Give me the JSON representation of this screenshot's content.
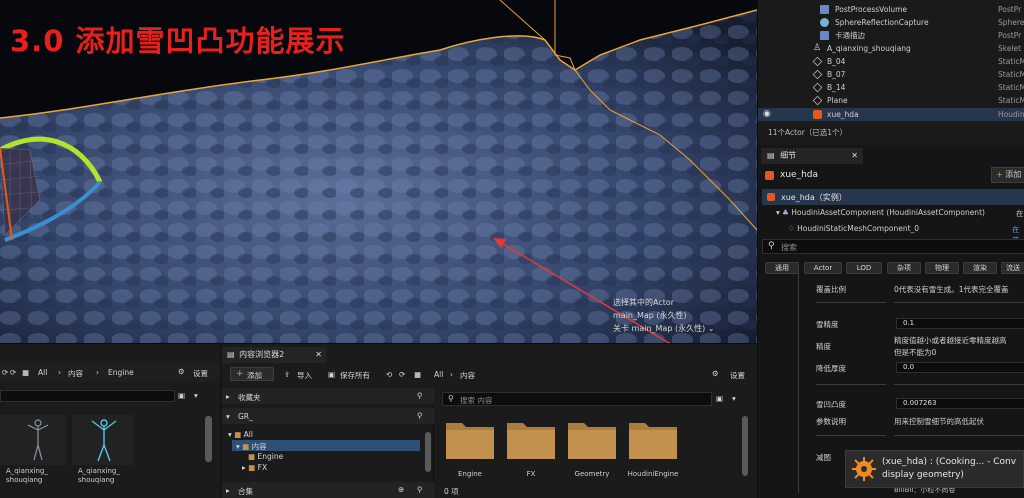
{
  "viewport": {
    "title": "3.0 添加雪凹凸功能展示",
    "info": [
      "选择其中的Actor",
      "main_Map (永久性)",
      "关卡 main_Map (永久性)"
    ]
  },
  "outliner": {
    "rows": [
      {
        "name": "PostProcessVolume",
        "type": "PostPr",
        "icon": "postprocess-icon"
      },
      {
        "name": "SphereReflectionCapture",
        "type": "SphereR",
        "icon": "sphere-capture-icon"
      },
      {
        "name": "卡通描边",
        "type": "PostPr",
        "icon": "postprocess-icon"
      },
      {
        "name": "A_qianxing_shouqiang",
        "type": "Skelet",
        "icon": "skeletal-mesh-icon"
      },
      {
        "name": "B_04",
        "type": "StaticM",
        "icon": "static-mesh-icon"
      },
      {
        "name": "B_07",
        "type": "StaticM",
        "icon": "static-mesh-icon"
      },
      {
        "name": "B_14",
        "type": "StaticM",
        "icon": "static-mesh-icon"
      },
      {
        "name": "Plane",
        "type": "StaticM",
        "icon": "static-mesh-icon"
      },
      {
        "name": "xue_hda",
        "type": "Houdin",
        "icon": "houdini-icon"
      }
    ],
    "count": "11个Actor（已选1个）"
  },
  "details": {
    "tab": "细节",
    "actor_name": "xue_hda",
    "add_button": "添加",
    "instance_label": "xue_hda（实例）",
    "component_1": "HoudiniAssetComponent (HoudiniAssetComponent)",
    "component_1_edit": "在",
    "component_2": "HoudiniStaticMeshComponent_0",
    "component_2_edit": "在蓝",
    "search_placeholder": "搜索",
    "categories": [
      "通用",
      "Actor",
      "LOD",
      "杂项",
      "物理",
      "渲染",
      "流送"
    ],
    "props": [
      {
        "label": "覆盖比例",
        "value": "0代表没有雪生成。1代表完全覆盖"
      },
      {
        "label": "雪精度",
        "value": "0.1"
      },
      {
        "label": "精度",
        "value": "精度值越小或者越接近零精度越高",
        "value2": "但是不能为0"
      },
      {
        "label": "降低厚度",
        "value": "0.0"
      },
      {
        "label": "雪凹凸度",
        "value": "0.007263"
      },
      {
        "label": "参数说明",
        "value": "用来控制雪细节的高低起伏"
      },
      {
        "label": "减图",
        "value": ""
      }
    ],
    "bottom_text": "BillBll：小粒不尚卷"
  },
  "toast": {
    "line1": "(xue_hda) : (Cooking... - Conv",
    "line2": "display geometry)"
  },
  "content_left": {
    "breadcrumb": [
      "All",
      "内容",
      "Engine"
    ],
    "settings": "设置",
    "assets": [
      {
        "label": "A_qianxing_",
        "label2": "shouqiang"
      },
      {
        "label": "A_qianxing_",
        "label2": "shouqiang"
      }
    ]
  },
  "content_browser": {
    "tab": "内容浏览器2",
    "add": "添加",
    "import": "导入",
    "save_all": "保存所有",
    "breadcrumb": [
      "All",
      "内容"
    ],
    "settings": "设置",
    "favorites": "收藏夹",
    "project": "GR_",
    "tree": [
      "All",
      "内容",
      "Engine",
      "FX"
    ],
    "collections": "合集",
    "search_placeholder": "搜索 内容",
    "folders": [
      "Engine",
      "FX",
      "Geometry",
      "HoudiniEngine"
    ],
    "item_count": "0 项"
  },
  "colors": {
    "accent": "#e8201c",
    "selection": "#26374d",
    "folder": "#c1914d",
    "annotation": "#e03a35"
  }
}
